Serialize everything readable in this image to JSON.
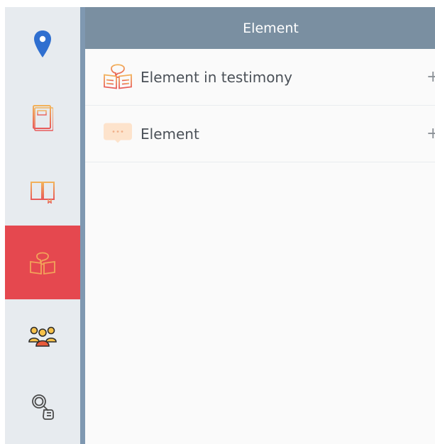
{
  "sidebar": {
    "items": [
      {
        "icon": "map-pin-icon"
      },
      {
        "icon": "document-icon"
      },
      {
        "icon": "open-book-icon"
      },
      {
        "icon": "testimony-book-icon",
        "active": true
      },
      {
        "icon": "people-group-icon"
      },
      {
        "icon": "magnifier-hand-icon"
      }
    ]
  },
  "panel": {
    "title": "Element",
    "items": [
      {
        "label": "Element in testimony",
        "action": "+",
        "icon": "speech-book-icon"
      },
      {
        "label": "Element",
        "action": "+",
        "icon": "chat-bubble-icon"
      }
    ]
  },
  "colors": {
    "accent_active": "#e5484f",
    "header_bg": "#7a8fa1",
    "sidebar_bg": "#e7ebef",
    "sidebar_divider": "#7f98b1",
    "icon_orange": "#f0a35a",
    "icon_red": "#e85a5a",
    "pin_blue": "#2f6fd0"
  }
}
